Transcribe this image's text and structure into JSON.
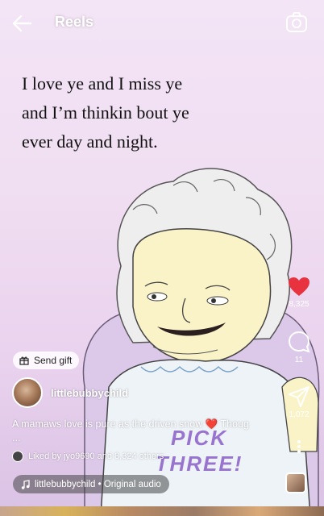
{
  "header": {
    "title": "Reels"
  },
  "post": {
    "caption_art_lines": [
      "I love ye and I miss ye",
      "and I’m thinkin bout ye",
      "ever day and night."
    ],
    "art_text_lines": [
      "PICK",
      "THREE!"
    ],
    "username": "littlebubbychild",
    "description": "A mamaws love is pure as the driven snow ❤️ Thoug",
    "description_more": "...",
    "liked_by": "Liked by jyo9690 and 8,324 others",
    "audio": "littlebubbychild • Original audio",
    "send_gift": "Send gift"
  },
  "actions": {
    "likes": "8,325",
    "comments": "11",
    "shares": "1,072"
  },
  "colors": {
    "heart": "#e8323f",
    "background": "#f0ddf1",
    "accent_text": "#8a5fc9"
  },
  "icons": [
    "back-arrow-icon",
    "camera-icon",
    "heart-icon",
    "comment-icon",
    "share-icon",
    "more-icon",
    "gift-icon",
    "music-note-icon"
  ]
}
